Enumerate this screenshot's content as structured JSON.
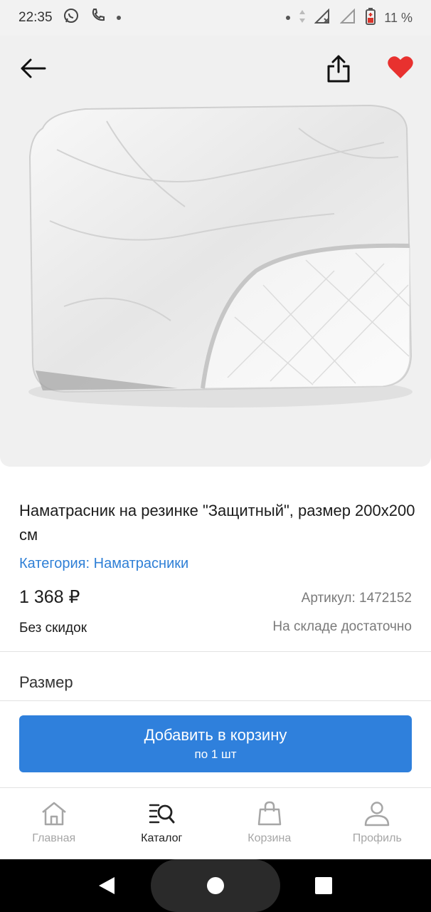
{
  "status_bar": {
    "time": "22:35",
    "battery": "11 %"
  },
  "product": {
    "title": "Наматрасник на резинке \"Защитный\", размер 200х200 см",
    "category_prefix": "Категория:",
    "category_value": "Наматрасники",
    "price": "1 368 ₽",
    "sku": "Артикул: 1472152",
    "discount": "Без скидок",
    "stock": "На складе достаточно",
    "size_label": "Размер",
    "favorite": true
  },
  "cart_button": {
    "label": "Добавить в корзину",
    "sublabel": "по 1 шт"
  },
  "tabs": [
    {
      "label": "Главная",
      "icon": "home-icon",
      "active": false
    },
    {
      "label": "Каталог",
      "icon": "catalog-search-icon",
      "active": true
    },
    {
      "label": "Корзина",
      "icon": "shopping-bag-icon",
      "active": false
    },
    {
      "label": "Профиль",
      "icon": "profile-icon",
      "active": false
    }
  ],
  "colors": {
    "accent": "#2f80dc",
    "link": "#2e7fd6",
    "favorite": "#e8312f"
  }
}
